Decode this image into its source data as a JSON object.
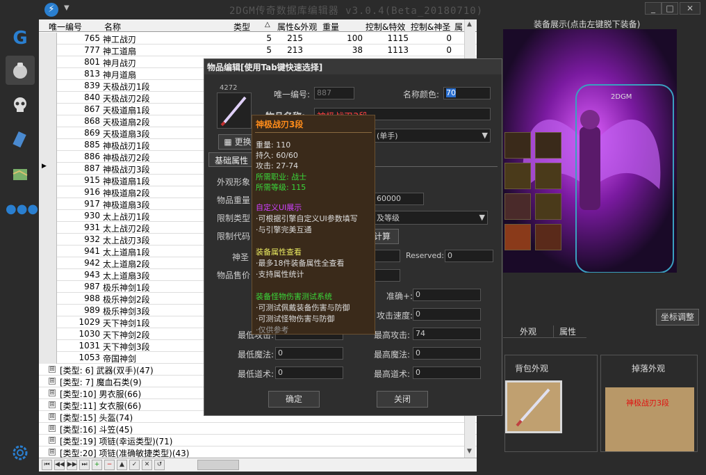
{
  "app": {
    "title": "2DGM传奇数据库编辑器 v3.0.4(Beta_20180710)"
  },
  "window": {
    "minimize": "_",
    "maximize": "□",
    "close": "✕"
  },
  "grid": {
    "headers": [
      "唯一编号",
      "名称",
      "类型",
      "△",
      "属性&外观",
      "重量",
      "控制&特效",
      "控制&神圣",
      "属"
    ],
    "rows": [
      {
        "id": "765",
        "name": "神工战刃",
        "type": "5",
        "look": "215",
        "weight": "100",
        "ctrl": "1115",
        "holy": "0"
      },
      {
        "id": "777",
        "name": "神工道扇",
        "type": "5",
        "look": "213",
        "weight": "38",
        "ctrl": "1113",
        "holy": "0"
      },
      {
        "id": "801",
        "name": "神月战刃"
      },
      {
        "id": "813",
        "name": "神月道扇"
      },
      {
        "id": "839",
        "name": "天极战刃1段"
      },
      {
        "id": "840",
        "name": "天极战刃2段"
      },
      {
        "id": "867",
        "name": "天极道扇1段"
      },
      {
        "id": "868",
        "name": "天极道扇2段"
      },
      {
        "id": "869",
        "name": "天极道扇3段"
      },
      {
        "id": "885",
        "name": "神极战刃1段"
      },
      {
        "id": "886",
        "name": "神极战刃2段"
      },
      {
        "id": "887",
        "name": "神极战刃3段"
      },
      {
        "id": "915",
        "name": "神极道扇1段"
      },
      {
        "id": "916",
        "name": "神极道扇2段"
      },
      {
        "id": "917",
        "name": "神极道扇3段"
      },
      {
        "id": "930",
        "name": "太上战刃1段"
      },
      {
        "id": "931",
        "name": "太上战刃2段"
      },
      {
        "id": "932",
        "name": "太上战刃3段"
      },
      {
        "id": "941",
        "name": "太上道扇1段"
      },
      {
        "id": "942",
        "name": "太上道扇2段"
      },
      {
        "id": "943",
        "name": "太上道扇3段"
      },
      {
        "id": "987",
        "name": "极乐神剑1段"
      },
      {
        "id": "988",
        "name": "极乐神剑2段"
      },
      {
        "id": "989",
        "name": "极乐神剑3段"
      },
      {
        "id": "1029",
        "name": "天下神剑1段"
      },
      {
        "id": "1030",
        "name": "天下神剑2段"
      },
      {
        "id": "1031",
        "name": "天下神剑3段"
      },
      {
        "id": "1053",
        "name": "帝国神剑"
      }
    ],
    "groups": [
      "[类型: 6] 武器(双手)(47)",
      "[类型: 7] 魔血石类(9)",
      "[类型:10] 男衣服(66)",
      "[类型:11] 女衣服(66)",
      "[类型:15] 头盔(74)",
      "[类型:16] 斗笠(45)",
      "[类型:19] 项链(幸运类型)(71)",
      "[类型:20] 项链(准确敏捷类型)(43)"
    ],
    "expand_icon": "⊞"
  },
  "nav": [
    "⏮",
    "◀◀",
    "▶▶",
    "⏭",
    "+",
    "−",
    "▲",
    "✓",
    "✕",
    "↺"
  ],
  "sidebar": {
    "logo": "G",
    "icons": [
      "bag-icon",
      "skull-icon",
      "scroll-icon",
      "map-icon",
      "more-icon",
      "settings-icon"
    ]
  },
  "dialog": {
    "title": "物品编辑[使用Tab键快速选择]",
    "item_number": "4272",
    "id_label": "唯一编号:",
    "id_value": "887",
    "color_label": "名称颜色:",
    "color_value": "70",
    "name_label": "物品名称:",
    "name_value": "神极战刃3段",
    "replace_btn": "更换",
    "hand_value": "(单手)",
    "tab_basic": "基础属性",
    "look_label": "外观形象",
    "weight_label": "物品重量",
    "weight_value": "60000",
    "limit_type_label": "限制类型",
    "limit_type_value": "及等级",
    "limit_code_label": "限制代码",
    "calc_btn": "计算",
    "holy_label": "神圣",
    "reserved_label": "Reserved:",
    "reserved_value": "0",
    "price_label": "物品售价",
    "acc_label": "准确+:",
    "acc_value": "0",
    "speed_label": "攻击速度:",
    "speed_value": "0",
    "min_atk_label": "最低攻击:",
    "max_atk_label": "最高攻击:",
    "max_atk_value": "74",
    "min_mag_label": "最低魔法:",
    "min_mag_value": "0",
    "max_mag_label": "最高魔法:",
    "max_mag_value": "0",
    "min_tao_label": "最低道术:",
    "min_tao_value": "0",
    "max_tao_label": "最高道术:",
    "max_tao_value": "0",
    "ok_btn": "确定",
    "close_btn": "关闭"
  },
  "tooltip": {
    "title": "神极战刃3段",
    "weight": "重量: 110",
    "dura": "持久: 60/60",
    "atk": "攻击: 27-74",
    "job": "所需职业: 战士",
    "level": "所需等级: 115",
    "s1": "自定义UI展示",
    "s1a": "·可根据引擎自定义UI参数填写",
    "s1b": "·与引擎完美互通",
    "s2": "装备属性查看",
    "s2a": "·最多18件装备属性全查看",
    "s2b": "·支持属性统计",
    "s3": "装备怪物伤害测试系统",
    "s3a": "·可测试佩戴装备伤害与防御",
    "s3b": "·可测试怪物伤害与防御",
    "s3c": "·仅供参考"
  },
  "right": {
    "title": "装备展示(点击左键脱下装备)",
    "badge": "2DGM",
    "coord_btn": "坐标调整",
    "tabs": [
      "外观",
      "属性"
    ],
    "bag_label": "背包外观",
    "drop_label": "掉落外观",
    "drop_item_name": "神极战刃3段"
  },
  "colors": {
    "accent": "#2a7fd0",
    "purple": "#a020f0",
    "tip_title": "#ff8c1a",
    "tip_green": "#3ad83a",
    "tip_purple": "#d040ff",
    "tip_yellow": "#e8e860"
  }
}
